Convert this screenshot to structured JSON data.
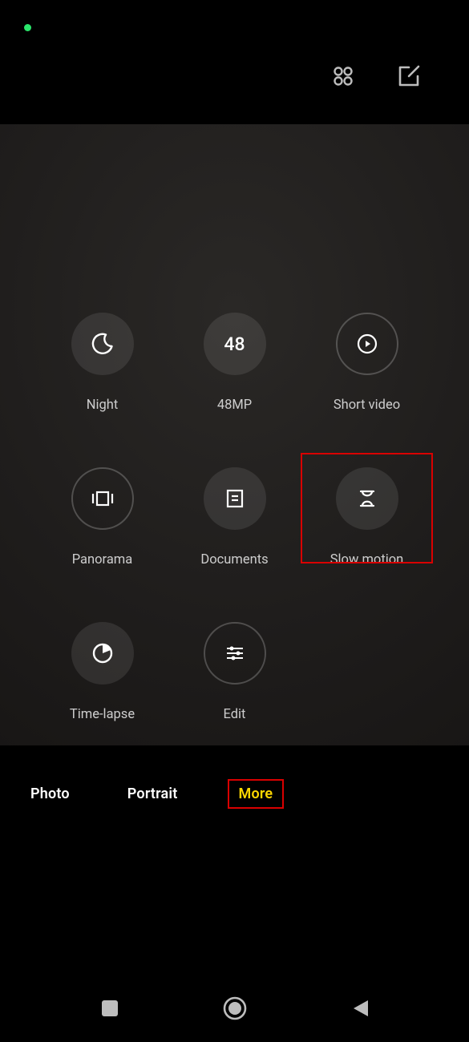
{
  "modes": {
    "night": {
      "label": "Night"
    },
    "mp48": {
      "label": "48MP",
      "number": "48"
    },
    "short_video": {
      "label": "Short video"
    },
    "panorama": {
      "label": "Panorama"
    },
    "documents": {
      "label": "Documents"
    },
    "slow_motion": {
      "label": "Slow motion"
    },
    "time_lapse": {
      "label": "Time-lapse"
    },
    "edit": {
      "label": "Edit"
    }
  },
  "tabs": {
    "photo": "Photo",
    "portrait": "Portrait",
    "more": "More"
  }
}
